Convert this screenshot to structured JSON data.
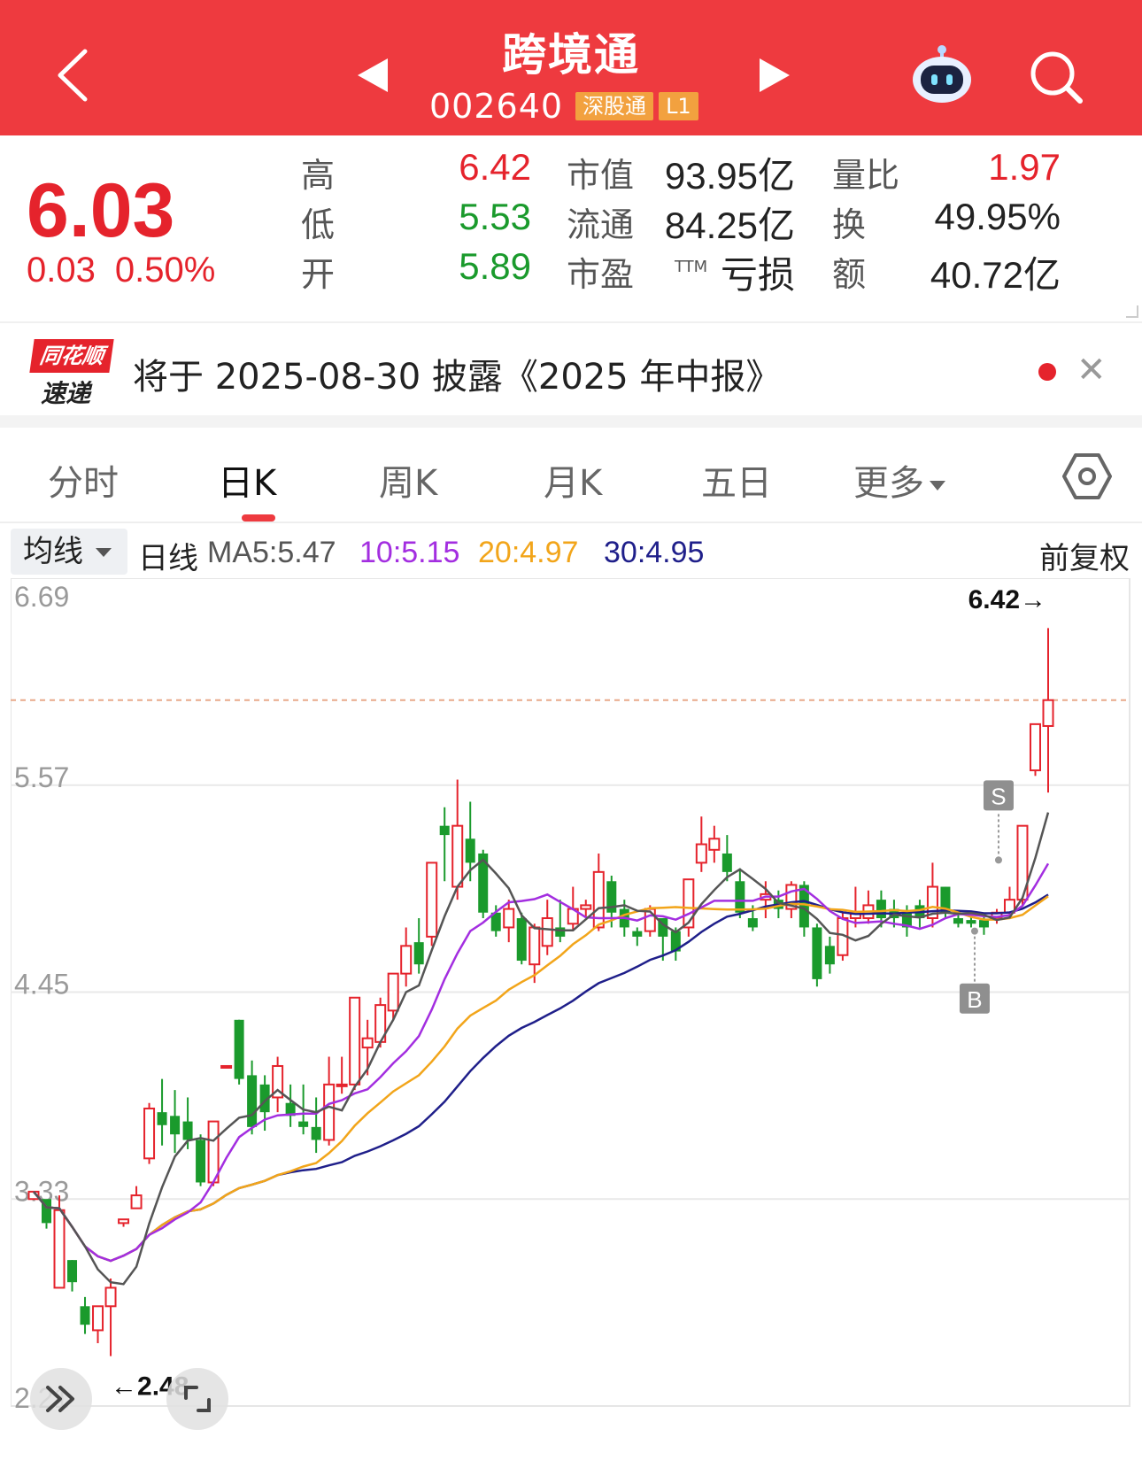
{
  "header": {
    "title": "跨境通",
    "code": "002640",
    "market_badge": "深股通",
    "level_badge": "L1"
  },
  "quote": {
    "price": "6.03",
    "change": "0.03",
    "change_pct": "0.50%",
    "labels": {
      "high": "高",
      "low": "低",
      "open": "开",
      "market_cap": "市值",
      "float_cap": "流通",
      "pe": "市盈",
      "pe_sup": "TTM",
      "volume_ratio": "量比",
      "turnover": "换",
      "amount": "额"
    },
    "values": {
      "high": "6.42",
      "low": "5.53",
      "open": "5.89",
      "market_cap": "93.95亿",
      "float_cap": "84.25亿",
      "pe": "亏损",
      "volume_ratio": "1.97",
      "turnover": "49.95%",
      "amount": "40.72亿"
    },
    "colors": {
      "up": "#e5232c",
      "down": "#1a9a2c"
    }
  },
  "banner": {
    "logo_top": "同花顺",
    "logo_bottom": "速递",
    "text": "将于 2025-08-30 披露《2025 年中报》",
    "close_icon": "close-icon"
  },
  "tabs": [
    {
      "label": "分时",
      "active": false
    },
    {
      "label": "日K",
      "active": true
    },
    {
      "label": "周K",
      "active": false
    },
    {
      "label": "月K",
      "active": false
    },
    {
      "label": "五日",
      "active": false
    },
    {
      "label": "更多",
      "active": false
    }
  ],
  "ma_bar": {
    "selector": "均线",
    "period": "日线",
    "ma5": "MA5:5.47",
    "ma10": "10:5.15",
    "ma20": "20:4.97",
    "ma30": "30:4.95",
    "adjust": "前复权",
    "colors": {
      "ma5": "#555555",
      "ma10": "#a32ee0",
      "ma20": "#f2a51a",
      "ma30": "#1f1f8a"
    }
  },
  "chart_data": {
    "type": "candlestick",
    "y_ticks": [
      "6.69",
      "5.57",
      "4.45",
      "3.33",
      "2.21"
    ],
    "ylim": [
      2.21,
      6.69
    ],
    "dashed_line": 6.03,
    "max_label": "6.42→",
    "min_label": "←2.48",
    "signals": {
      "sell": "S",
      "buy": "B"
    },
    "candles": [
      [
        3.33,
        3.37,
        3.33,
        3.37
      ],
      [
        3.33,
        3.2,
        3.17,
        3.2
      ],
      [
        2.85,
        3.27,
        2.85,
        3.35
      ],
      [
        3.0,
        2.88,
        2.83,
        3.0
      ],
      [
        2.75,
        2.65,
        2.6,
        2.8
      ],
      [
        2.62,
        2.75,
        2.55,
        2.75
      ],
      [
        2.75,
        2.85,
        2.48,
        2.9
      ],
      [
        3.2,
        3.22,
        3.18,
        3.22
      ],
      [
        3.28,
        3.35,
        3.28,
        3.4
      ],
      [
        3.55,
        3.82,
        3.52,
        3.85
      ],
      [
        3.8,
        3.73,
        3.62,
        3.98
      ],
      [
        3.78,
        3.68,
        3.58,
        3.92
      ],
      [
        3.75,
        3.65,
        3.6,
        3.88
      ],
      [
        3.65,
        3.42,
        3.4,
        3.68
      ],
      [
        3.42,
        3.75,
        3.4,
        3.75
      ],
      [
        4.05,
        4.05,
        4.05,
        4.05
      ],
      [
        4.3,
        3.98,
        3.95,
        4.3
      ],
      [
        4.0,
        3.72,
        3.68,
        4.08
      ],
      [
        3.95,
        3.8,
        3.7,
        4.0
      ],
      [
        3.88,
        4.05,
        3.8,
        4.1
      ],
      [
        3.85,
        3.78,
        3.72,
        3.95
      ],
      [
        3.75,
        3.72,
        3.68,
        3.95
      ],
      [
        3.72,
        3.65,
        3.58,
        3.88
      ],
      [
        3.65,
        3.95,
        3.62,
        4.1
      ],
      [
        3.95,
        3.95,
        3.9,
        4.1
      ],
      [
        3.95,
        4.42,
        3.92,
        4.42
      ],
      [
        4.15,
        4.2,
        4.0,
        4.3
      ],
      [
        4.18,
        4.38,
        4.15,
        4.42
      ],
      [
        4.35,
        4.55,
        4.3,
        4.55
      ],
      [
        4.55,
        4.7,
        4.48,
        4.8
      ],
      [
        4.72,
        4.6,
        4.55,
        4.85
      ],
      [
        4.75,
        5.15,
        4.7,
        5.15
      ],
      [
        5.35,
        5.3,
        5.05,
        5.45
      ],
      [
        5.02,
        5.35,
        4.95,
        5.6
      ],
      [
        5.28,
        5.15,
        5.05,
        5.48
      ],
      [
        5.2,
        4.88,
        4.85,
        5.22
      ],
      [
        4.88,
        4.78,
        4.75,
        4.92
      ],
      [
        4.8,
        4.9,
        4.72,
        4.95
      ],
      [
        4.85,
        4.62,
        4.6,
        4.88
      ],
      [
        4.6,
        4.8,
        4.5,
        4.82
      ],
      [
        4.7,
        4.85,
        4.65,
        4.95
      ],
      [
        4.8,
        4.75,
        4.72,
        4.95
      ],
      [
        4.82,
        4.9,
        4.78,
        5.02
      ],
      [
        4.9,
        4.92,
        4.85,
        4.95
      ],
      [
        4.8,
        5.1,
        4.78,
        5.2
      ],
      [
        5.05,
        4.88,
        4.8,
        5.08
      ],
      [
        4.9,
        4.8,
        4.75,
        4.95
      ],
      [
        4.78,
        4.75,
        4.7,
        4.8
      ],
      [
        4.78,
        4.9,
        4.75,
        4.92
      ],
      [
        4.85,
        4.75,
        4.62,
        4.85
      ],
      [
        4.78,
        4.67,
        4.62,
        4.8
      ],
      [
        4.8,
        5.06,
        4.75,
        5.06
      ],
      [
        5.15,
        5.25,
        5.1,
        5.4
      ],
      [
        5.22,
        5.28,
        5.15,
        5.35
      ],
      [
        5.2,
        5.1,
        5.05,
        5.3
      ],
      [
        5.05,
        4.88,
        4.85,
        5.12
      ],
      [
        4.85,
        4.8,
        4.78,
        4.92
      ],
      [
        4.95,
        4.98,
        4.85,
        5.05
      ],
      [
        4.95,
        4.9,
        4.85,
        5.0
      ],
      [
        4.9,
        5.03,
        4.85,
        5.05
      ],
      [
        5.03,
        4.8,
        4.75,
        5.05
      ],
      [
        4.8,
        4.52,
        4.48,
        4.82
      ],
      [
        4.7,
        4.6,
        4.55,
        4.75
      ],
      [
        4.65,
        4.85,
        4.62,
        4.88
      ],
      [
        4.85,
        4.88,
        4.8,
        5.02
      ],
      [
        4.85,
        4.92,
        4.82,
        5.0
      ],
      [
        4.95,
        4.85,
        4.8,
        5.0
      ],
      [
        4.9,
        4.85,
        4.8,
        4.95
      ],
      [
        4.88,
        4.8,
        4.75,
        4.92
      ],
      [
        4.92,
        4.85,
        4.8,
        4.95
      ],
      [
        4.85,
        5.02,
        4.8,
        5.15
      ],
      [
        5.02,
        4.88,
        4.85,
        5.02
      ],
      [
        4.85,
        4.82,
        4.8,
        4.88
      ],
      [
        4.84,
        4.82,
        4.8,
        4.86
      ],
      [
        4.84,
        4.8,
        4.76,
        4.86
      ],
      [
        4.85,
        4.88,
        4.82,
        4.9
      ],
      [
        4.88,
        4.95,
        4.85,
        5.02
      ],
      [
        4.95,
        5.35,
        4.92,
        5.35
      ],
      [
        5.65,
        5.9,
        5.62,
        5.9
      ],
      [
        5.89,
        6.03,
        5.53,
        6.42
      ]
    ],
    "ma5_label": "MA5",
    "ma10_label": "10",
    "ma20_label": "20",
    "ma30_label": "30"
  }
}
